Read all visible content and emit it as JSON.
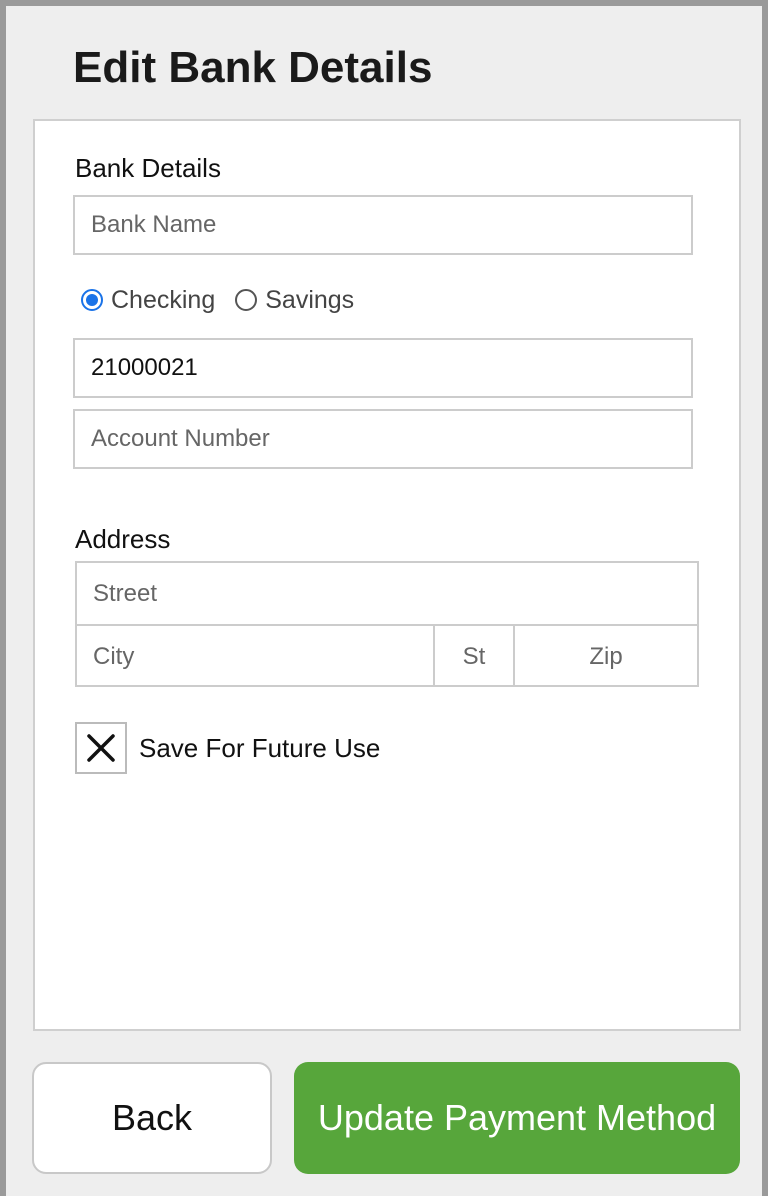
{
  "dialog": {
    "title": "Edit Bank Details"
  },
  "bank_details": {
    "section_label": "Bank Details",
    "bank_name_placeholder": "Bank Name",
    "account_type": {
      "options": [
        {
          "label": "Checking",
          "checked": true
        },
        {
          "label": "Savings",
          "checked": false
        }
      ]
    },
    "routing_number_value": "21000021",
    "account_number_placeholder": "Account Number"
  },
  "address": {
    "section_label": "Address",
    "street_placeholder": "Street",
    "city_placeholder": "City",
    "state_placeholder": "St",
    "zip_placeholder": "Zip"
  },
  "save_for_future": {
    "label": "Save For Future Use",
    "checked": true
  },
  "buttons": {
    "back_label": "Back",
    "update_label": "Update Payment Method"
  },
  "colors": {
    "accent_radio": "#1a73e8",
    "primary_button": "#57a63b"
  }
}
